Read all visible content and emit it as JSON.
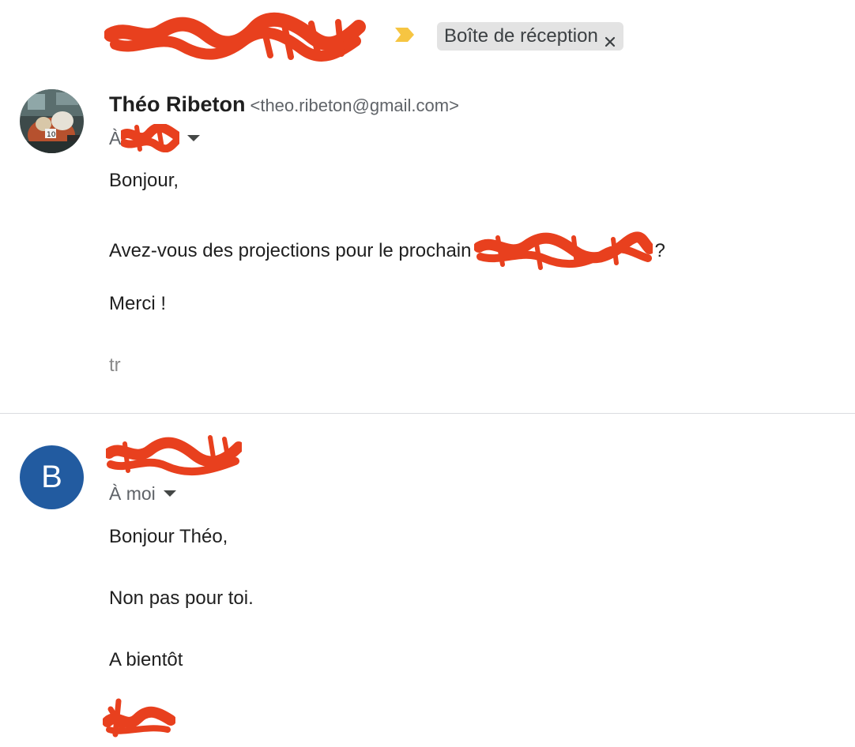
{
  "thread": {
    "subject_redacted": true,
    "label_chip": "Boîte de réception",
    "colors": {
      "redaction": "#e8401e",
      "importance_marker": "#f6c542",
      "chip_bg": "#e3e3e3",
      "avatar_letter_bg": "#225ba0",
      "separator": "#dadce0"
    }
  },
  "messages": [
    {
      "sender_name": "Théo Ribeton",
      "sender_email": "<theo.ribeton@gmail.com>",
      "avatar_type": "photo",
      "to_prefix": "À",
      "recipient_redacted": true,
      "body": {
        "greeting": "Bonjour,",
        "question_prefix": "Avez-vous des projections pour le prochain",
        "question_suffix": "?",
        "thanks": "Merci !",
        "signature": "tr"
      }
    },
    {
      "sender_redacted": true,
      "avatar_letter": "B",
      "to_label": "À moi",
      "body": {
        "greeting": "Bonjour Théo,",
        "line1": "Non pas pour toi.",
        "closing": "A bientôt"
      },
      "signature_redacted": true
    }
  ]
}
